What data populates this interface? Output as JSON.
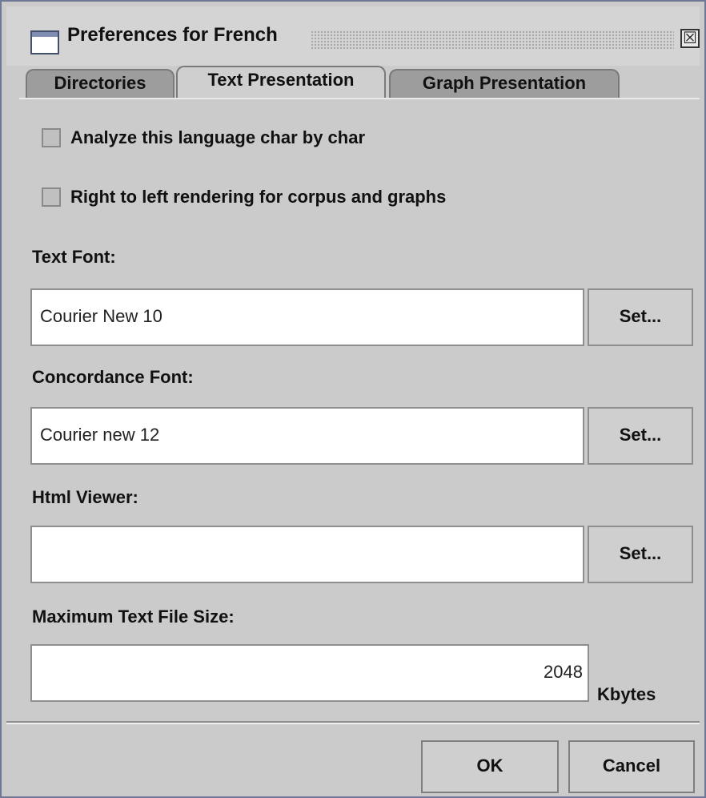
{
  "window": {
    "title": "Preferences for French",
    "close_glyph": "☒"
  },
  "tabs": [
    {
      "label": "Directories",
      "active": false
    },
    {
      "label": "Text Presentation",
      "active": true
    },
    {
      "label": "Graph Presentation",
      "active": false
    }
  ],
  "options": {
    "char_by_char": {
      "label": "Analyze this language char by char",
      "checked": false
    },
    "rtl": {
      "label": "Right to left rendering for corpus and graphs",
      "checked": false
    }
  },
  "text_font": {
    "label": "Text Font:",
    "value": "Courier New  10",
    "button": "Set..."
  },
  "concordance_font": {
    "label": "Concordance Font:",
    "value": "Courier new  12",
    "button": "Set..."
  },
  "html_viewer": {
    "label": "Html Viewer:",
    "value": "",
    "button": "Set..."
  },
  "max_file_size": {
    "label": "Maximum Text File Size:",
    "value": "2048",
    "unit": "Kbytes"
  },
  "footer": {
    "ok": "OK",
    "cancel": "Cancel"
  },
  "colors": {
    "frame": "#6f7894",
    "background": "#cbcbcb",
    "inactive_tab": "#9d9d9d"
  }
}
